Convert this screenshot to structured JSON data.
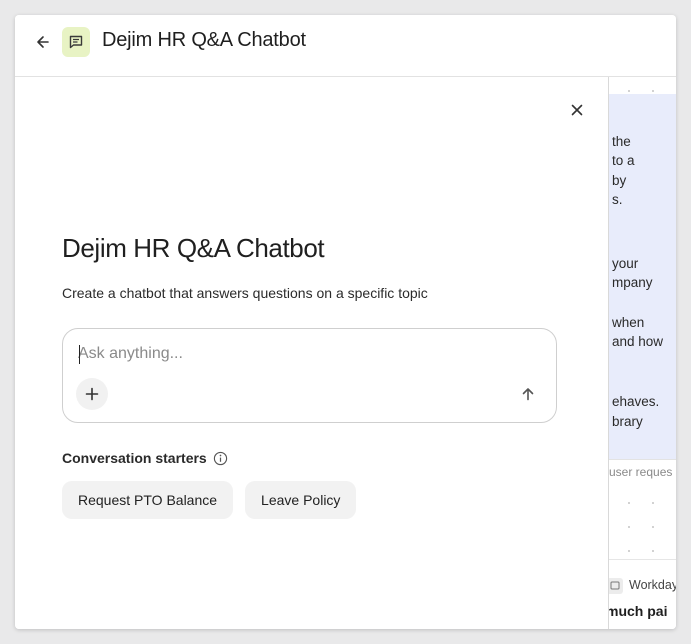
{
  "header": {
    "title": "Dejim HR Q&A Chatbot",
    "back_icon": "arrow-left-icon",
    "app_icon": "chat-bubble-icon",
    "app_icon_bg": "#e8f3c4"
  },
  "dialog": {
    "title": "Dejim HR Q&A Chatbot",
    "subtitle": "Create a chatbot that answers questions on a specific topic",
    "close_icon": "close-icon",
    "composer": {
      "placeholder": "Ask anything...",
      "value": "",
      "add_icon": "plus-icon",
      "send_icon": "arrow-up-icon"
    },
    "starters": {
      "label": "Conversation starters",
      "info_icon": "info-icon",
      "items": [
        {
          "label": "Request PTO Balance"
        },
        {
          "label": "Leave Policy"
        }
      ]
    }
  },
  "background": {
    "fragments": [
      "the",
      "to a",
      "by",
      "s.",
      "your",
      "mpany",
      "when",
      "and how",
      "ehaves.",
      "brary"
    ],
    "request_fragment": "user reques",
    "workday_label": "Workday",
    "workday_text": "much pai",
    "card_color": "#e8ecfb"
  }
}
